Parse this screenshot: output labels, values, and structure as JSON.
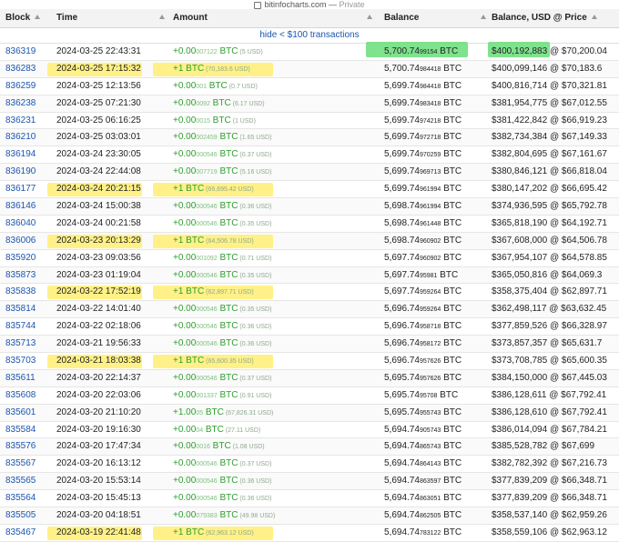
{
  "browser": {
    "url": "bitinfocharts.com",
    "mode": "Private"
  },
  "headers": {
    "block": "Block",
    "time": "Time",
    "amount": "Amount",
    "balance": "Balance",
    "balance_usd": "Balance, USD @ Price"
  },
  "hide_link": "hide < $100 transactions",
  "colors": {
    "link": "#1a55b0",
    "amount_green": "#2e9e2e",
    "highlight_yellow": "#fff07a",
    "highlight_green": "#70e080"
  },
  "rows": [
    {
      "block": "836319",
      "time": "2024-03-25 22:43:31",
      "amt_main": "+0.00",
      "amt_small": "007122",
      "amt_unit": " BTC",
      "amt_usd": " (5 USD)",
      "bal_main": "5,700.74",
      "bal_small": "99154",
      "bal_unit": " BTC",
      "usd": "$400,192,883 @ $70,200.04",
      "hl_time": false,
      "hl_amt": false,
      "hl_green": true
    },
    {
      "block": "836283",
      "time": "2024-03-25 17:15:32",
      "amt_main": "+1",
      "amt_small": "",
      "amt_unit": " BTC",
      "amt_usd": " (70,183.6 USD)",
      "bal_main": "5,700.74",
      "bal_small": "984418",
      "bal_unit": " BTC",
      "usd": "$400,099,146 @ $70,183.6",
      "hl_time": true,
      "hl_amt": true,
      "hl_green": false
    },
    {
      "block": "836259",
      "time": "2024-03-25 12:13:56",
      "amt_main": "+0.00",
      "amt_small": "001",
      "amt_unit": " BTC",
      "amt_usd": " (0.7 USD)",
      "bal_main": "5,699.74",
      "bal_small": "984418",
      "bal_unit": " BTC",
      "usd": "$400,816,714 @ $70,321.81",
      "hl_time": false,
      "hl_amt": false,
      "hl_green": false
    },
    {
      "block": "836238",
      "time": "2024-03-25 07:21:30",
      "amt_main": "+0.00",
      "amt_small": "0092",
      "amt_unit": " BTC",
      "amt_usd": " (6.17 USD)",
      "bal_main": "5,699.74",
      "bal_small": "983418",
      "bal_unit": " BTC",
      "usd": "$381,954,775 @ $67,012.55",
      "hl_time": false,
      "hl_amt": false,
      "hl_green": false
    },
    {
      "block": "836231",
      "time": "2024-03-25 06:16:25",
      "amt_main": "+0.00",
      "amt_small": "0015",
      "amt_unit": " BTC",
      "amt_usd": " (1 USD)",
      "bal_main": "5,699.74",
      "bal_small": "974218",
      "bal_unit": " BTC",
      "usd": "$381,422,842 @ $66,919.23",
      "hl_time": false,
      "hl_amt": false,
      "hl_green": false
    },
    {
      "block": "836210",
      "time": "2024-03-25 03:03:01",
      "amt_main": "+0.00",
      "amt_small": "002459",
      "amt_unit": " BTC",
      "amt_usd": " (1.65 USD)",
      "bal_main": "5,699.74",
      "bal_small": "972718",
      "bal_unit": " BTC",
      "usd": "$382,734,384 @ $67,149.33",
      "hl_time": false,
      "hl_amt": false,
      "hl_green": false
    },
    {
      "block": "836194",
      "time": "2024-03-24 23:30:05",
      "amt_main": "+0.00",
      "amt_small": "000546",
      "amt_unit": " BTC",
      "amt_usd": " (0.37 USD)",
      "bal_main": "5,699.74",
      "bal_small": "970259",
      "bal_unit": " BTC",
      "usd": "$382,804,695 @ $67,161.67",
      "hl_time": false,
      "hl_amt": false,
      "hl_green": false
    },
    {
      "block": "836190",
      "time": "2024-03-24 22:44:08",
      "amt_main": "+0.00",
      "amt_small": "007719",
      "amt_unit": " BTC",
      "amt_usd": " (5.16 USD)",
      "bal_main": "5,699.74",
      "bal_small": "969713",
      "bal_unit": " BTC",
      "usd": "$380,846,121 @ $66,818.04",
      "hl_time": false,
      "hl_amt": false,
      "hl_green": false
    },
    {
      "block": "836177",
      "time": "2024-03-24 20:21:15",
      "amt_main": "+1",
      "amt_small": "",
      "amt_unit": " BTC",
      "amt_usd": " (66,695.42 USD)",
      "bal_main": "5,699.74",
      "bal_small": "961994",
      "bal_unit": " BTC",
      "usd": "$380,147,202 @ $66,695.42",
      "hl_time": true,
      "hl_amt": true,
      "hl_green": false
    },
    {
      "block": "836146",
      "time": "2024-03-24 15:00:38",
      "amt_main": "+0.00",
      "amt_small": "000546",
      "amt_unit": " BTC",
      "amt_usd": " (0.36 USD)",
      "bal_main": "5,698.74",
      "bal_small": "961994",
      "bal_unit": " BTC",
      "usd": "$374,936,595 @ $65,792.78",
      "hl_time": false,
      "hl_amt": false,
      "hl_green": false
    },
    {
      "block": "836040",
      "time": "2024-03-24 00:21:58",
      "amt_main": "+0.00",
      "amt_small": "000546",
      "amt_unit": " BTC",
      "amt_usd": " (0.35 USD)",
      "bal_main": "5,698.74",
      "bal_small": "961448",
      "bal_unit": " BTC",
      "usd": "$365,818,190 @ $64,192.71",
      "hl_time": false,
      "hl_amt": false,
      "hl_green": false
    },
    {
      "block": "836006",
      "time": "2024-03-23 20:13:29",
      "amt_main": "+1",
      "amt_small": "",
      "amt_unit": " BTC",
      "amt_usd": " (64,506.78 USD)",
      "bal_main": "5,698.74",
      "bal_small": "960902",
      "bal_unit": " BTC",
      "usd": "$367,608,000 @ $64,506.78",
      "hl_time": true,
      "hl_amt": true,
      "hl_green": false
    },
    {
      "block": "835920",
      "time": "2024-03-23 09:03:56",
      "amt_main": "+0.00",
      "amt_small": "001092",
      "amt_unit": " BTC",
      "amt_usd": " (0.71 USD)",
      "bal_main": "5,697.74",
      "bal_small": "960902",
      "bal_unit": " BTC",
      "usd": "$367,954,107 @ $64,578.85",
      "hl_time": false,
      "hl_amt": false,
      "hl_green": false
    },
    {
      "block": "835873",
      "time": "2024-03-23 01:19:04",
      "amt_main": "+0.00",
      "amt_small": "000546",
      "amt_unit": " BTC",
      "amt_usd": " (0.35 USD)",
      "bal_main": "5,697.74",
      "bal_small": "95981",
      "bal_unit": " BTC",
      "usd": "$365,050,816 @ $64,069.3",
      "hl_time": false,
      "hl_amt": false,
      "hl_green": false
    },
    {
      "block": "835838",
      "time": "2024-03-22 17:52:19",
      "amt_main": "+1",
      "amt_small": "",
      "amt_unit": " BTC",
      "amt_usd": " (62,897.71 USD)",
      "bal_main": "5,697.74",
      "bal_small": "959264",
      "bal_unit": " BTC",
      "usd": "$358,375,404 @ $62,897.71",
      "hl_time": true,
      "hl_amt": true,
      "hl_green": false
    },
    {
      "block": "835814",
      "time": "2024-03-22 14:01:40",
      "amt_main": "+0.00",
      "amt_small": "000546",
      "amt_unit": " BTC",
      "amt_usd": " (0.35 USD)",
      "bal_main": "5,696.74",
      "bal_small": "959264",
      "bal_unit": " BTC",
      "usd": "$362,498,117 @ $63,632.45",
      "hl_time": false,
      "hl_amt": false,
      "hl_green": false
    },
    {
      "block": "835744",
      "time": "2024-03-22 02:18:06",
      "amt_main": "+0.00",
      "amt_small": "000546",
      "amt_unit": " BTC",
      "amt_usd": " (0.36 USD)",
      "bal_main": "5,696.74",
      "bal_small": "958718",
      "bal_unit": " BTC",
      "usd": "$377,859,526 @ $66,328.97",
      "hl_time": false,
      "hl_amt": false,
      "hl_green": false
    },
    {
      "block": "835713",
      "time": "2024-03-21 19:56:33",
      "amt_main": "+0.00",
      "amt_small": "000546",
      "amt_unit": " BTC",
      "amt_usd": " (0.36 USD)",
      "bal_main": "5,696.74",
      "bal_small": "958172",
      "bal_unit": " BTC",
      "usd": "$373,857,357 @ $65,631.7",
      "hl_time": false,
      "hl_amt": false,
      "hl_green": false
    },
    {
      "block": "835703",
      "time": "2024-03-21 18:03:38",
      "amt_main": "+1",
      "amt_small": "",
      "amt_unit": " BTC",
      "amt_usd": " (65,600.35 USD)",
      "bal_main": "5,696.74",
      "bal_small": "957626",
      "bal_unit": " BTC",
      "usd": "$373,708,785 @ $65,600.35",
      "hl_time": true,
      "hl_amt": true,
      "hl_green": false
    },
    {
      "block": "835611",
      "time": "2024-03-20 22:14:37",
      "amt_main": "+0.00",
      "amt_small": "000546",
      "amt_unit": " BTC",
      "amt_usd": " (0.37 USD)",
      "bal_main": "5,695.74",
      "bal_small": "957626",
      "bal_unit": " BTC",
      "usd": "$384,150,000 @ $67,445.03",
      "hl_time": false,
      "hl_amt": false,
      "hl_green": false
    },
    {
      "block": "835608",
      "time": "2024-03-20 22:03:06",
      "amt_main": "+0.00",
      "amt_small": "001337",
      "amt_unit": " BTC",
      "amt_usd": " (0.91 USD)",
      "bal_main": "5,695.74",
      "bal_small": "95708",
      "bal_unit": " BTC",
      "usd": "$386,128,611 @ $67,792.41",
      "hl_time": false,
      "hl_amt": false,
      "hl_green": false
    },
    {
      "block": "835601",
      "time": "2024-03-20 21:10:20",
      "amt_main": "+1.00",
      "amt_small": "05",
      "amt_unit": " BTC",
      "amt_usd": " (67,826.31 USD)",
      "bal_main": "5,695.74",
      "bal_small": "955743",
      "bal_unit": " BTC",
      "usd": "$386,128,610 @ $67,792.41",
      "hl_time": false,
      "hl_amt": false,
      "hl_green": false
    },
    {
      "block": "835584",
      "time": "2024-03-20 19:16:30",
      "amt_main": "+0.00",
      "amt_small": "04",
      "amt_unit": " BTC",
      "amt_usd": " (27.11 USD)",
      "bal_main": "5,694.74",
      "bal_small": "905743",
      "bal_unit": " BTC",
      "usd": "$386,014,094 @ $67,784.21",
      "hl_time": false,
      "hl_amt": false,
      "hl_green": false
    },
    {
      "block": "835576",
      "time": "2024-03-20 17:47:34",
      "amt_main": "+0.00",
      "amt_small": "0016",
      "amt_unit": " BTC",
      "amt_usd": " (1.08 USD)",
      "bal_main": "5,694.74",
      "bal_small": "865743",
      "bal_unit": " BTC",
      "usd": "$385,528,782 @ $67,699",
      "hl_time": false,
      "hl_amt": false,
      "hl_green": false
    },
    {
      "block": "835567",
      "time": "2024-03-20 16:13:12",
      "amt_main": "+0.00",
      "amt_small": "000546",
      "amt_unit": " BTC",
      "amt_usd": " (0.37 USD)",
      "bal_main": "5,694.74",
      "bal_small": "864143",
      "bal_unit": " BTC",
      "usd": "$382,782,392 @ $67,216.73",
      "hl_time": false,
      "hl_amt": false,
      "hl_green": false
    },
    {
      "block": "835565",
      "time": "2024-03-20 15:53:14",
      "amt_main": "+0.00",
      "amt_small": "000546",
      "amt_unit": " BTC",
      "amt_usd": " (0.36 USD)",
      "bal_main": "5,694.74",
      "bal_small": "863597",
      "bal_unit": " BTC",
      "usd": "$377,839,209 @ $66,348.71",
      "hl_time": false,
      "hl_amt": false,
      "hl_green": false
    },
    {
      "block": "835564",
      "time": "2024-03-20 15:45:13",
      "amt_main": "+0.00",
      "amt_small": "000546",
      "amt_unit": " BTC",
      "amt_usd": " (0.36 USD)",
      "bal_main": "5,694.74",
      "bal_small": "863051",
      "bal_unit": " BTC",
      "usd": "$377,839,209 @ $66,348.71",
      "hl_time": false,
      "hl_amt": false,
      "hl_green": false
    },
    {
      "block": "835505",
      "time": "2024-03-20 04:18:51",
      "amt_main": "+0.00",
      "amt_small": "079383",
      "amt_unit": " BTC",
      "amt_usd": " (49.98 USD)",
      "bal_main": "5,694.74",
      "bal_small": "862505",
      "bal_unit": " BTC",
      "usd": "$358,537,140 @ $62,959.26",
      "hl_time": false,
      "hl_amt": false,
      "hl_green": false
    },
    {
      "block": "835467",
      "time": "2024-03-19 22:41:48",
      "amt_main": "+1",
      "amt_small": "",
      "amt_unit": " BTC",
      "amt_usd": " (62,963.12 USD)",
      "bal_main": "5,694.74",
      "bal_small": "783122",
      "bal_unit": " BTC",
      "usd": "$358,559,106 @ $62,963.12",
      "hl_time": true,
      "hl_amt": true,
      "hl_green": false
    }
  ]
}
